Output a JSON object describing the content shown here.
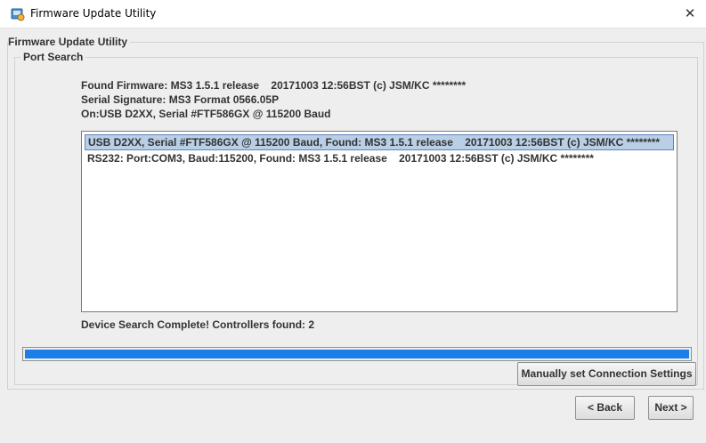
{
  "window": {
    "title": "Firmware Update Utility",
    "close_glyph": "✕"
  },
  "groups": {
    "outer_title": "Firmware Update Utility",
    "inner_title": "Port Search"
  },
  "info": {
    "found_firmware": "Found Firmware: MS3 1.5.1 release    20171003 12:56BST (c) JSM/KC ********",
    "serial_signature": "Serial Signature: MS3 Format 0566.05P",
    "connection": "On:USB D2XX, Serial #FTF586GX @ 115200 Baud"
  },
  "devices": [
    {
      "label": "USB D2XX, Serial #FTF586GX @ 115200 Baud, Found: MS3 1.5.1 release    20171003 12:56BST (c) JSM/KC ********",
      "selected": true
    },
    {
      "label": "RS232: Port:COM3, Baud:115200, Found: MS3 1.5.1 release    20171003 12:56BST (c) JSM/KC ********",
      "selected": false
    }
  ],
  "status": "Device Search Complete! Controllers found: 2",
  "progress": {
    "value": 1.0,
    "color": "#1c7fe8"
  },
  "buttons": {
    "manual": "Manually set Connection Settings",
    "back": "< Back",
    "next": "Next >"
  },
  "icons": {
    "app": "app-gear-icon",
    "close": "close-icon"
  }
}
